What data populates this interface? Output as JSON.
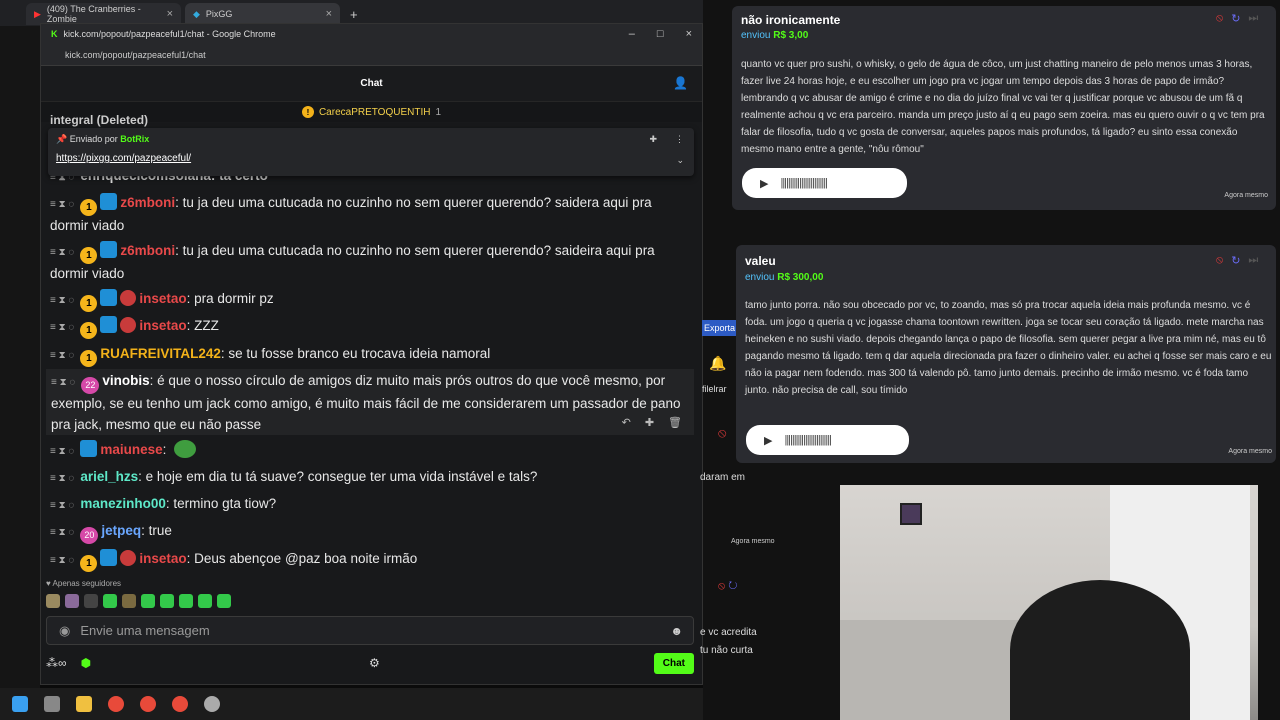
{
  "browser_tabs": [
    {
      "label": "(409) The Cranberries - Zombie"
    },
    {
      "label": "PixGG"
    }
  ],
  "popup": {
    "title": "kick.com/popout/pazpeaceful1/chat - Google Chrome",
    "url": "kick.com/popout/pazpeaceful1/chat",
    "chat_header": "Chat",
    "gift_banner": "CarecaPRETOQUENTIH",
    "gift_count": "1",
    "pinned": {
      "prefix": "Enviado por",
      "sender": "BotRix",
      "link": "https://pixgg.com/pazpeaceful/"
    },
    "partial_top": "integral (Deleted)",
    "partial_second": "enriquecicomsolana: ta certo"
  },
  "messages": [
    {
      "user": "z6mboni",
      "color": "#e8494a",
      "text": ": tu ja deu uma cutucada no cuzinho no sem querer querendo? saidera aqui pra dormir viado",
      "badges": "coin-sq"
    },
    {
      "user": "z6mboni",
      "color": "#e8494a",
      "text": ": tu ja deu uma cutucada no cuzinho no sem querer querendo? saideira aqui pra dormir viado",
      "badges": "coin-sq"
    },
    {
      "user": "insetao",
      "color": "#e8494a",
      "text": ": pra dormir pz",
      "badges": "coin-sq-hat"
    },
    {
      "user": "insetao",
      "color": "#e8494a",
      "text": ": ZZZ",
      "badges": "coin-sq-hat"
    },
    {
      "user": "RUAFREIVITAL242",
      "color": "#f3b21a",
      "text": ": se tu fosse branco eu trocava ideia namoral",
      "badges": "coin"
    },
    {
      "user": "vinobis",
      "color": "#ffffff",
      "text": ": é que o nosso círculo de amigos diz muito mais prós outros do que você mesmo, por exemplo, se eu tenho um jack como amigo, é muito mais fácil de me considerarem um passador de pano pra jack, mesmo que eu não passe",
      "badges": "sub",
      "sub_level": "22"
    },
    {
      "user": "maiunese",
      "color": "#e8494a",
      "text": ":",
      "badges": "sq"
    },
    {
      "user": "ariel_hzs",
      "color": "#5ee8c8",
      "text": ": e hoje em dia tu tá suave? consegue ter uma vida instável e tals?",
      "badges": ""
    },
    {
      "user": "manezinho00",
      "color": "#5ee8c8",
      "text": ": termino gta tiow?",
      "badges": ""
    },
    {
      "user": "jetpeq",
      "color": "#6aa7ff",
      "text": ": true",
      "badges": "sub",
      "sub_level": "20"
    },
    {
      "user": "insetao",
      "color": "#e8494a",
      "text": ": Deus abençoe @paz boa noite irmão",
      "badges": "coin-sq-hat"
    }
  ],
  "follow_only": "Apenas seguidores",
  "input_placeholder": "Envie uma mensagem",
  "send_label": "Chat",
  "overlay": {
    "donation1": {
      "name": "não ironicamente",
      "sent": "enviou",
      "amount": "R$ 3,00",
      "text": "quanto vc quer pro sushi, o whisky, o gelo de água de côco, um just chatting maneiro de pelo menos umas 3 horas, fazer live 24 horas hoje, e eu escolher um jogo pra vc jogar um tempo depois das 3 horas de papo de irmão? lembrando q vc abusar de amigo é crime e no dia do juízo final vc vai ter q justificar porque vc abusou de um fã q realmente achou q vc era parceiro. manda um preço justo aí q eu pago sem zoeira. mas eu quero ouvir o q vc tem pra falar de filosofia, tudo q vc gosta de conversar, aqueles papos mais profundos, tá ligado? eu sinto essa conexão mesmo mano entre a gente, \"nôu rômou\"",
      "ago": "Agora mesmo"
    },
    "donation2": {
      "name": "valeu",
      "sent": "enviou",
      "amount": "R$ 300,00",
      "text": "tamo junto porra. não sou obcecado por vc, to zoando, mas só pra trocar aquela ideia mais profunda mesmo. vc é foda. um jogo q queria q vc jogasse chama toontown rewritten. joga se tocar seu coração tá ligado. mete marcha nas heineken e no sushi viado. depois chegando lança o papo de filosofia. sem querer pegar a live pra mim né, mas eu tô pagando mesmo tá ligado. tem q dar aquela direcionada pra fazer o dinheiro valer. eu achei q fosse ser mais caro e eu não ia pagar nem fodendo. mas 300 tá valendo pô. tamo junto demais. precinho de irmão mesmo. vc é foda tamo junto. não precisa de call, sou tímido",
      "ago": "Agora mesmo"
    },
    "partial1": "daram em",
    "partial1_ago": "Agora mesmo",
    "partial2": "e vc acredita",
    "partial3": "tu não curta",
    "side_labels": [
      "Exporta",
      "filelrar"
    ]
  }
}
